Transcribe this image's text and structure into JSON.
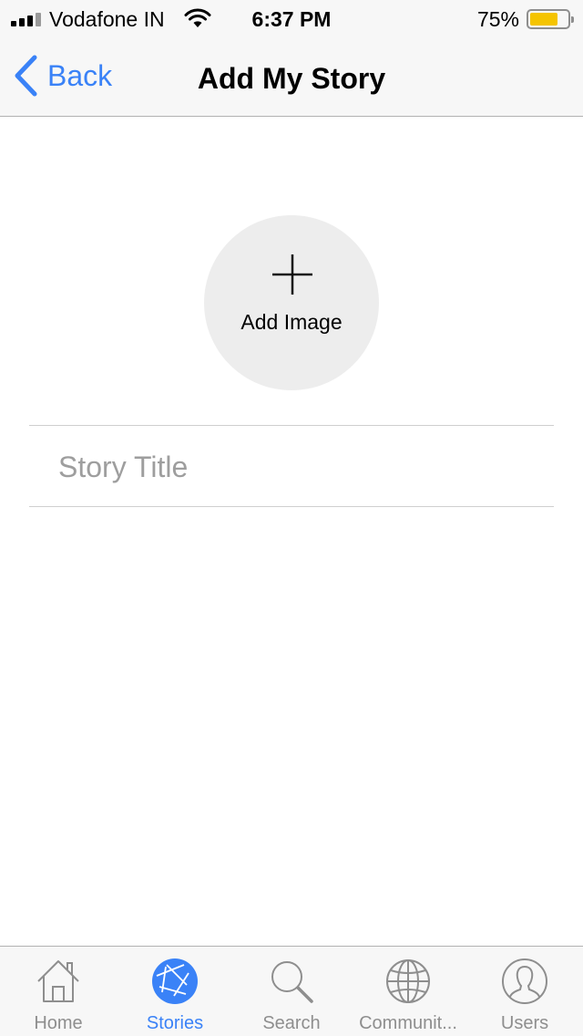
{
  "status_bar": {
    "carrier": "Vodafone IN",
    "time": "6:37 PM",
    "battery_percent": "75%",
    "battery_level": 0.75,
    "battery_color": "#f5c400",
    "signal_bars": 3,
    "signal_bars_total": 4
  },
  "nav": {
    "back_label": "Back",
    "title": "Add My Story",
    "accent_color": "#3a82f7"
  },
  "content": {
    "add_image_label": "Add Image",
    "story_title_placeholder": "Story Title",
    "story_title_value": ""
  },
  "tabs": [
    {
      "label": "Home",
      "icon": "home-icon",
      "active": false
    },
    {
      "label": "Stories",
      "icon": "stories-shutter-icon",
      "active": true
    },
    {
      "label": "Search",
      "icon": "search-icon",
      "active": false
    },
    {
      "label": "Communit...",
      "icon": "globe-icon",
      "active": false
    },
    {
      "label": "Users",
      "icon": "user-icon",
      "active": false
    }
  ]
}
